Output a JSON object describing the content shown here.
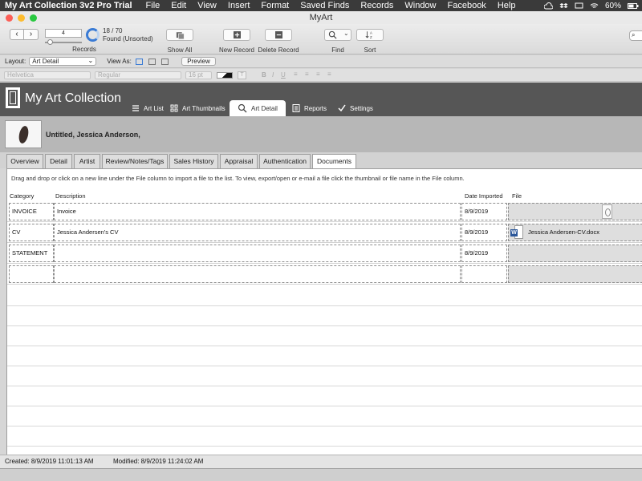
{
  "menubar": {
    "app_name": "My Art Collection 3v2 Pro Trial",
    "items": [
      "File",
      "Edit",
      "View",
      "Insert",
      "Format",
      "Saved Finds",
      "Records",
      "Window",
      "Facebook",
      "Help"
    ],
    "battery": "60%"
  },
  "window": {
    "title": "MyArt"
  },
  "toolbar": {
    "record_number": "4",
    "records_label": "Records",
    "found_count": "18 / 70",
    "found_status": "Found (Unsorted)",
    "show_all_label": "Show All",
    "new_record_label": "New Record",
    "delete_record_label": "Delete Record",
    "find_label": "Find",
    "sort_label": "Sort"
  },
  "layoutbar": {
    "layout_label": "Layout:",
    "layout_value": "Art Detail",
    "view_as_label": "View As:",
    "preview_label": "Preview"
  },
  "formatbar": {
    "font": "Helvetica",
    "style": "Regular",
    "size": "16 pt"
  },
  "header": {
    "app_title": "My Art Collection",
    "nav": [
      "Art List",
      "Art Thumbnails",
      "Art Detail",
      "Reports",
      "Settings"
    ]
  },
  "record": {
    "title": "Untitled, Jessica Anderson,"
  },
  "tabs": [
    "Overview",
    "Detail",
    "Artist",
    "Review/Notes/Tags",
    "Sales History",
    "Appraisal",
    "Authentication",
    "Documents"
  ],
  "documents": {
    "instructions": "Drag and drop or click on a new line under the File column to import a file to the list. To view, export/open or e-mail a file click the thumbnail or file name in the File column.",
    "columns": {
      "category": "Category",
      "description": "Description",
      "date_imported": "Date Imported",
      "file": "File"
    },
    "rows": [
      {
        "category": "INVOICE",
        "description": "Invoice",
        "date": "8/9/2019",
        "file": ""
      },
      {
        "category": "CV",
        "description": "Jessica Andersen's CV",
        "date": "8/9/2019",
        "file": "Jessica Andersen-CV.docx"
      },
      {
        "category": "STATEMENT",
        "description": "",
        "date": "8/9/2019",
        "file": ""
      },
      {
        "category": "",
        "description": "",
        "date": "",
        "file": ""
      }
    ]
  },
  "status": {
    "created": "Created: 8/9/2019 11:01:13 AM",
    "modified": "Modified: 8/9/2019 11:24:02 AM"
  },
  "colors": {
    "header_bg": "#565656",
    "accent_blue": "#3a7bd5",
    "word_blue": "#2b579a"
  }
}
